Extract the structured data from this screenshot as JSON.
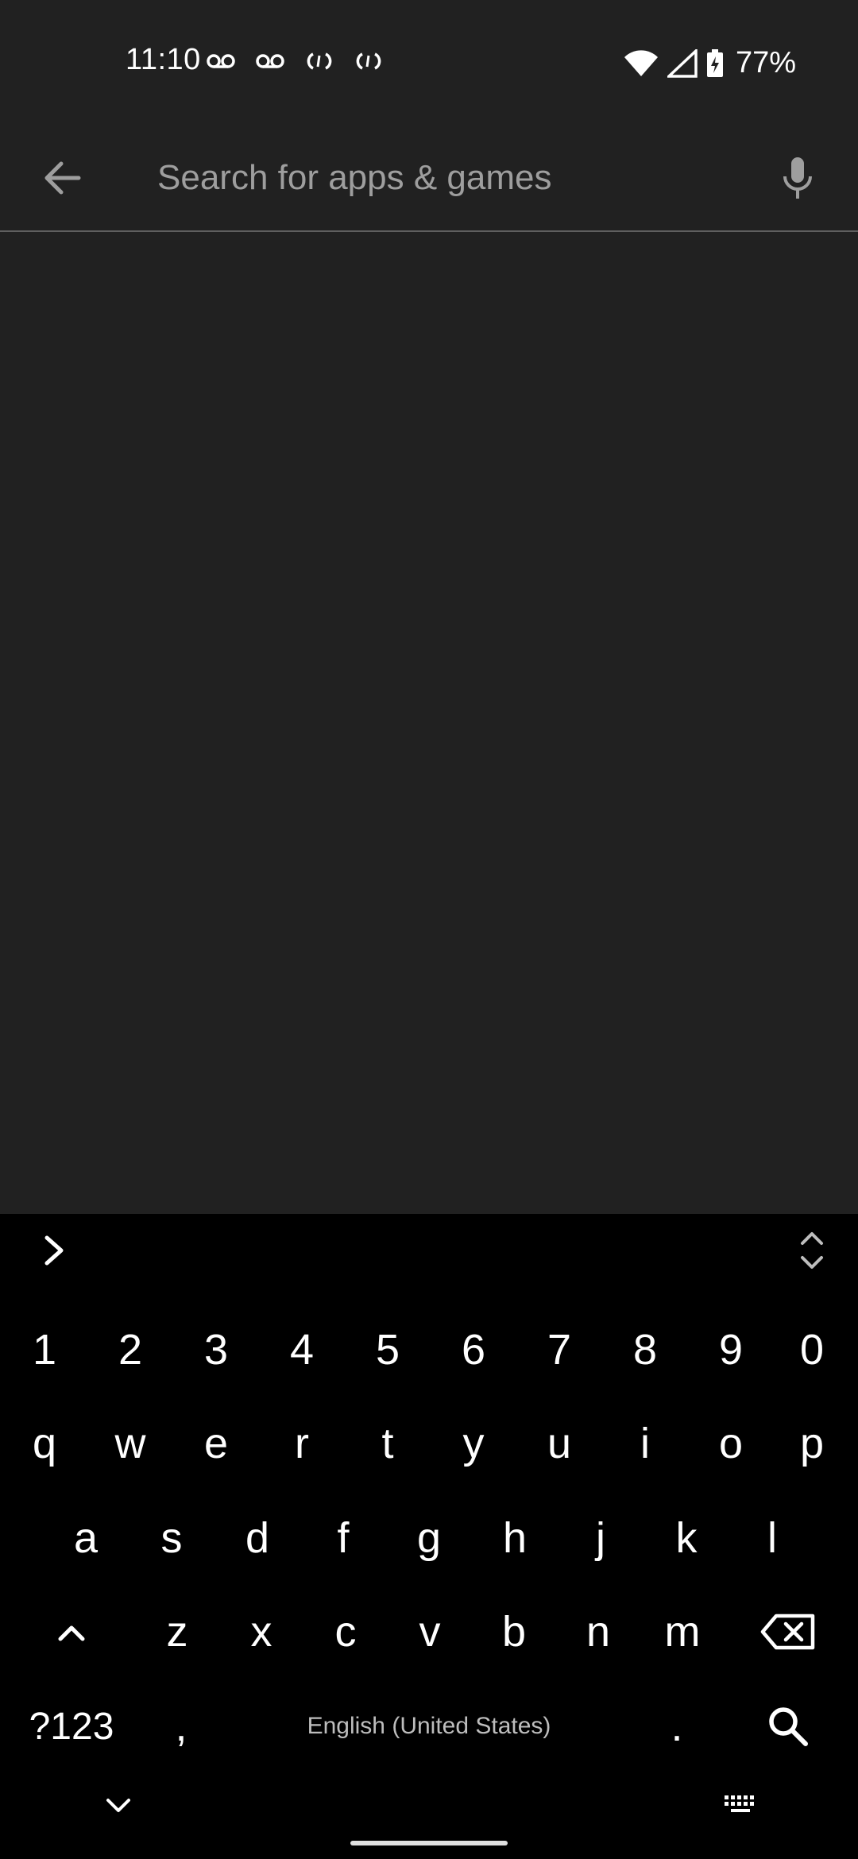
{
  "status_bar": {
    "time": "11:10",
    "battery_percent": "77%",
    "icons": [
      "voicemail-icon",
      "voicemail-icon",
      "sync-icon",
      "sync-icon",
      "wifi-icon",
      "cell-signal-icon",
      "battery-charging-icon"
    ]
  },
  "search": {
    "placeholder": "Search for apps & games",
    "value": ""
  },
  "keyboard": {
    "number_row": [
      "1",
      "2",
      "3",
      "4",
      "5",
      "6",
      "7",
      "8",
      "9",
      "0"
    ],
    "row1": [
      "q",
      "w",
      "e",
      "r",
      "t",
      "y",
      "u",
      "i",
      "o",
      "p"
    ],
    "row2": [
      "a",
      "s",
      "d",
      "f",
      "g",
      "h",
      "j",
      "k",
      "l"
    ],
    "row3": [
      "z",
      "x",
      "c",
      "v",
      "b",
      "n",
      "m"
    ],
    "symbols_label": "?123",
    "comma": ",",
    "space_label": "English (United States)",
    "period": "."
  },
  "colors": {
    "background": "#212121",
    "keyboard_bg": "#000000",
    "placeholder": "#9e9e9e"
  }
}
